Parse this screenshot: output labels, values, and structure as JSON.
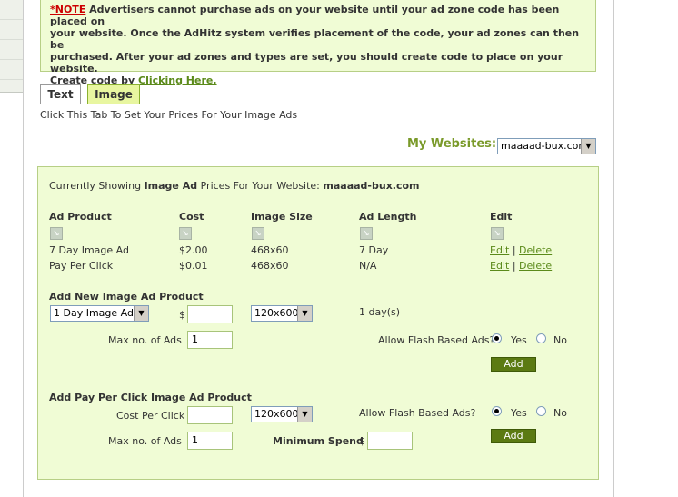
{
  "note": {
    "label": "*NOTE",
    "text_1": " Advertisers cannot purchase ads on your website until your ad zone code has been placed on",
    "text_2": "your website. Once the AdHitz system verifies placement of the code, your ad zones can then be",
    "text_3": "purchased. After your ad zones and types are set, you should create code to place on your website.",
    "text_4": "Create code by ",
    "link": "Clicking Here."
  },
  "tabs": {
    "text": "Text",
    "image": "Image",
    "hint": "Click This Tab To Set Your Prices For Your Image Ads"
  },
  "websites": {
    "label": "My Websites:",
    "selected": "maaaad-bux.com"
  },
  "panel": {
    "showing_prefix": "Currently Showing ",
    "showing_bold": "Image Ad",
    "showing_mid": " Prices For Your Website: ",
    "site": "maaaad-bux.com",
    "columns": [
      "Ad Product",
      "Cost",
      "Image Size",
      "Ad Length",
      "Edit"
    ],
    "rows": [
      {
        "product": "7 Day Image Ad",
        "cost": "$2.00",
        "size": "468x60",
        "length": "7 Day",
        "edit": "Edit",
        "sep": "|",
        "delete": "Delete"
      },
      {
        "product": "Pay Per Click",
        "cost": "$0.01",
        "size": "468x60",
        "length": "N/A",
        "edit": "Edit",
        "sep": "|",
        "delete": "Delete"
      }
    ]
  },
  "add_image": {
    "title": "Add New Image Ad Product",
    "product_select": "1 Day Image Ad",
    "dollar": "$",
    "price_value": "",
    "size_select": "120x600",
    "length_text": "1 day(s)",
    "max_label": "Max no. of Ads",
    "max_value": "1",
    "flash_label": "Allow Flash Based Ads?",
    "yes": "Yes",
    "no": "No",
    "add": "Add"
  },
  "add_ppc": {
    "title": "Add Pay Per Click Image Ad Product",
    "cost_label": "Cost Per Click $",
    "cost_value": "",
    "size_select": "120x600",
    "flash_label": "Allow Flash Based Ads?",
    "yes": "Yes",
    "no": "No",
    "max_label": "Max no. of Ads",
    "max_value": "1",
    "min_spend_label": "Minimum Spend",
    "dollar": "$",
    "min_spend_value": "",
    "add": "Add"
  },
  "icons": {
    "sort": "sort-arrow-icon",
    "dropdown": "chevron-down-icon"
  },
  "colors": {
    "panel_bg": "#f0fcd5",
    "accent_green": "#7a9a2a",
    "button_green": "#5b7a12",
    "note_red": "#cc0000"
  }
}
